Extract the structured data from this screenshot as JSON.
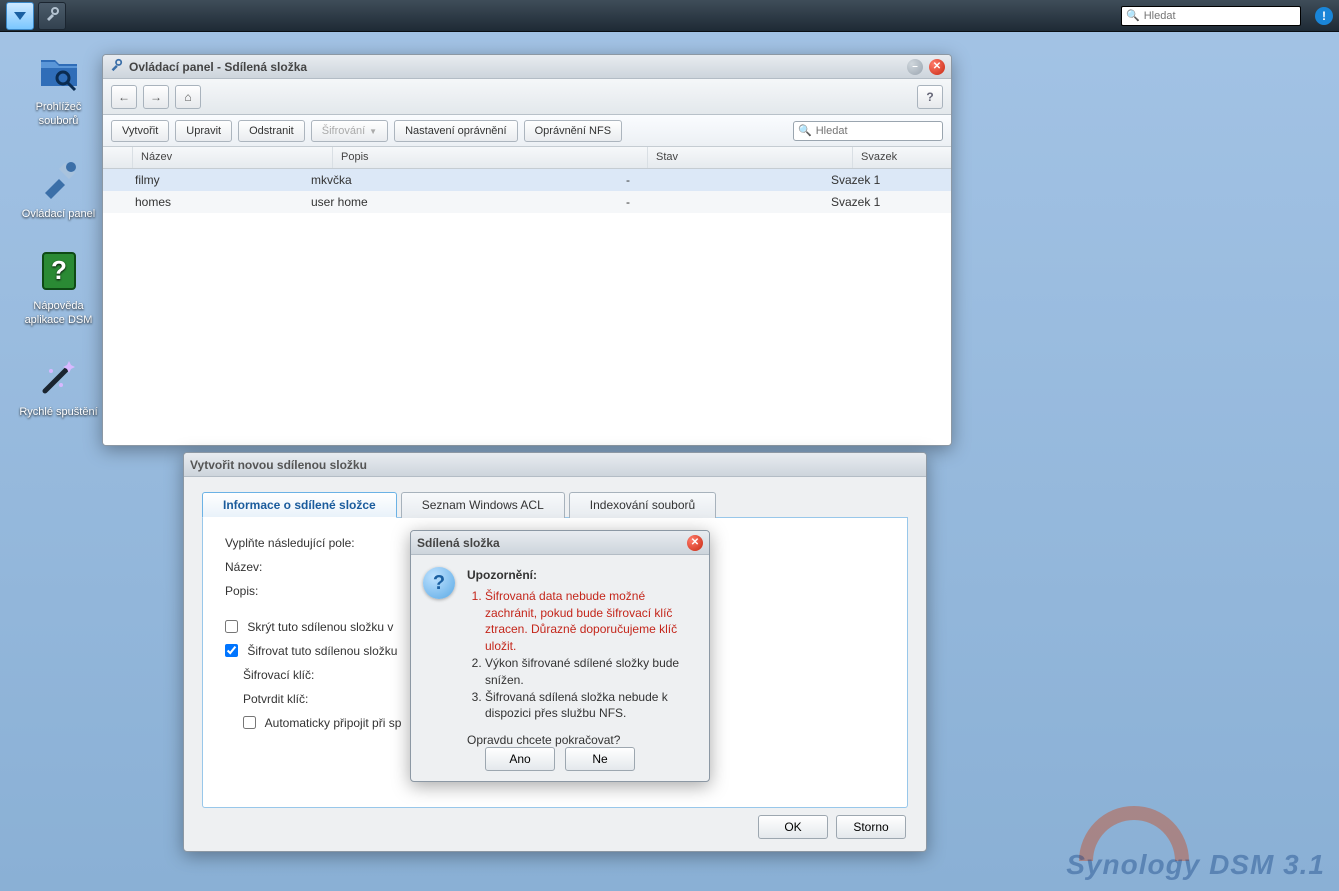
{
  "taskbar": {
    "search_placeholder": "Hledat"
  },
  "desktop": {
    "items": [
      {
        "label": "Prohlížeč souborů"
      },
      {
        "label": "Ovládací panel"
      },
      {
        "label": "Nápověda aplikace DSM"
      },
      {
        "label": "Rychlé spuštění"
      }
    ]
  },
  "cp_window": {
    "title": "Ovládací panel - Sdílená složka",
    "toolbar": {
      "create": "Vytvořit",
      "edit": "Upravit",
      "remove": "Odstranit",
      "encrypt": "Šifrování",
      "perm": "Nastavení oprávnění",
      "nfs": "Oprávnění NFS",
      "search_placeholder": "Hledat"
    },
    "columns": {
      "name": "Název",
      "desc": "Popis",
      "status": "Stav",
      "volume": "Svazek"
    },
    "rows": [
      {
        "name": "filmy",
        "desc": "mkvčka",
        "status": "-",
        "volume": "Svazek 1"
      },
      {
        "name": "homes",
        "desc": "user home",
        "status": "-",
        "volume": "Svazek 1"
      }
    ]
  },
  "create_dialog": {
    "title": "Vytvořit novou sdílenou složku",
    "tabs": {
      "info": "Informace o sdílené složce",
      "acl": "Seznam Windows ACL",
      "index": "Indexování souborů"
    },
    "form": {
      "intro": "Vyplňte následující pole:",
      "name_label": "Název:",
      "desc_label": "Popis:",
      "hide_label": "Skrýt tuto sdílenou složku v",
      "encrypt_label": "Šifrovat tuto sdílenou složku",
      "key_label": "Šifrovací klíč:",
      "confirm_label": "Potvrdit klíč:",
      "automount_label": "Automaticky připojit při sp"
    },
    "buttons": {
      "ok": "OK",
      "cancel": "Storno"
    }
  },
  "warn_dialog": {
    "title": "Sdílená složka",
    "heading": "Upozornění:",
    "items": [
      "Šifrovaná data nebude možné zachránit, pokud bude šifrovací klíč ztracen. Důrazně doporučujeme klíč uložit.",
      "Výkon šifrované sdílené složky bude snížen.",
      "Šifrovaná sdílená složka nebude k dispozici přes službu NFS."
    ],
    "question": "Opravdu chcete pokračovat?",
    "yes": "Ano",
    "no": "Ne"
  },
  "watermark": "Synology DSM 3.1"
}
